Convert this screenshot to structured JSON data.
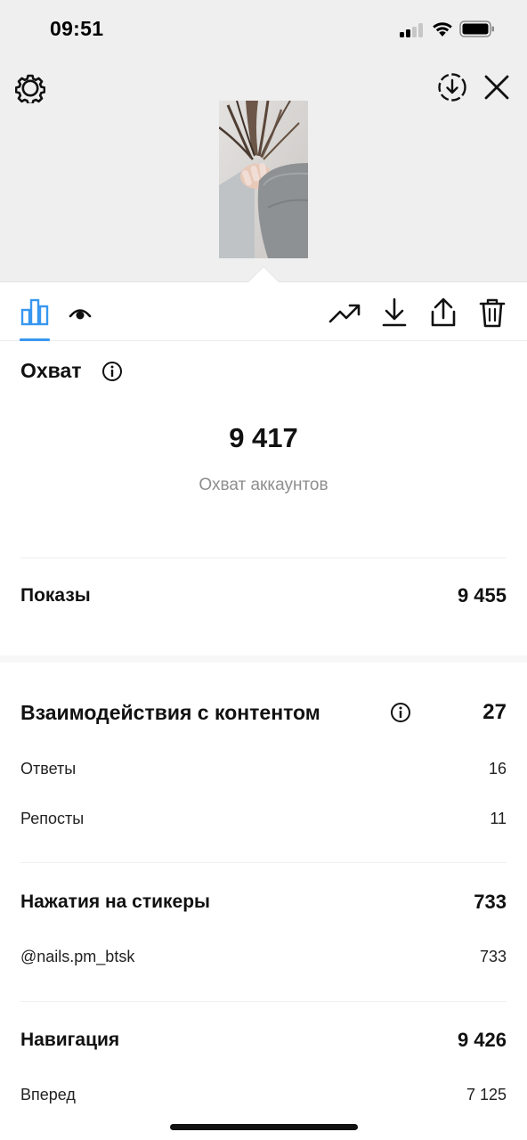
{
  "status_bar": {
    "time": "09:51"
  },
  "header": {
    "settings_icon": "gear-icon",
    "download_icon": "download-circle-icon",
    "close_icon": "close-icon"
  },
  "toolbar": {
    "tabs": [
      "bar-chart-icon",
      "eye-icon"
    ],
    "actions": [
      "trend-icon",
      "download-icon",
      "share-icon",
      "trash-icon"
    ],
    "accent_color": "#3897f0"
  },
  "reach": {
    "title": "Охват",
    "value": "9 417",
    "caption": "Охват аккаунтов"
  },
  "impressions": {
    "label": "Показы",
    "value": "9 455"
  },
  "interactions": {
    "title": "Взаимодействия с контентом",
    "total": "27",
    "rows": [
      {
        "label": "Ответы",
        "value": "16"
      },
      {
        "label": "Репосты",
        "value": "11"
      }
    ]
  },
  "sticker_taps": {
    "title": "Нажатия на стикеры",
    "total": "733",
    "rows": [
      {
        "label": "@nails.pm_btsk",
        "value": "733"
      }
    ]
  },
  "navigation": {
    "title": "Навигация",
    "total": "9 426",
    "rows": [
      {
        "label": "Вперед",
        "value": "7 125"
      }
    ]
  }
}
